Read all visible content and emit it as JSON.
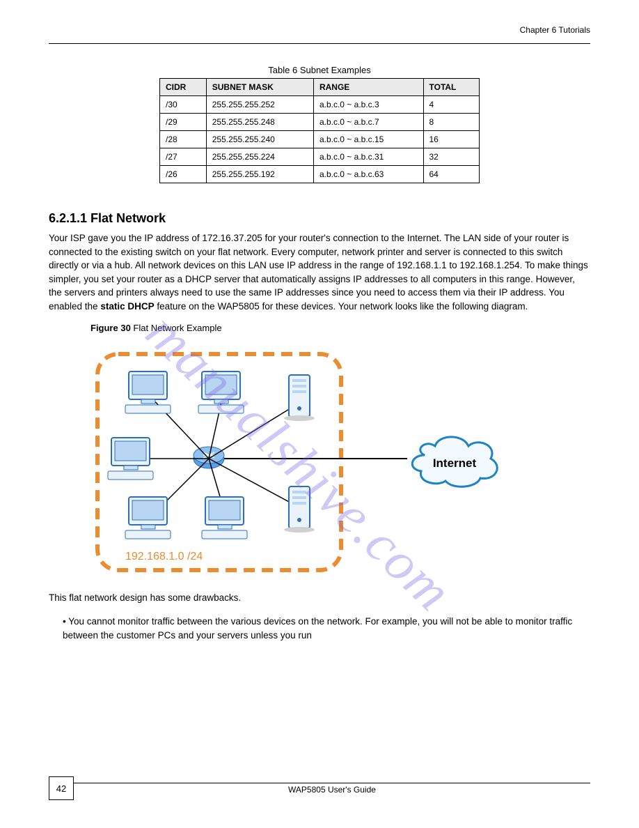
{
  "header": {
    "chapter": "Chapter 6 Tutorials"
  },
  "table": {
    "caption": "Table 6   Subnet Examples",
    "headers": [
      "CIDR",
      "SUBNET MASK",
      "RANGE",
      "TOTAL"
    ],
    "rows": [
      [
        "/30",
        "255.255.255.252",
        "a.b.c.0 ~ a.b.c.3",
        "4"
      ],
      [
        "/29",
        "255.255.255.248",
        "a.b.c.0 ~ a.b.c.7",
        "8"
      ],
      [
        "/28",
        "255.255.255.240",
        "a.b.c.0 ~ a.b.c.15",
        "16"
      ],
      [
        "/27",
        "255.255.255.224",
        "a.b.c.0 ~ a.b.c.31",
        "32"
      ],
      [
        "/26",
        "255.255.255.192",
        "a.b.c.0 ~ a.b.c.63",
        "64"
      ]
    ]
  },
  "section": {
    "heading": "6.2.1.1  Flat Network",
    "p1_a": "Your ISP gave you the IP address of 172.16.37.205 for your router's connection to the Internet. The LAN side of your router is connected to the existing switch on your flat network. Every computer, network printer and server is connected to this switch directly or via a hub. All network devices on this LAN use IP address in the range of 192.168.1.1 to 192.168.1.254. To make things simpler, you set your router as a DHCP server that automatically assigns IP addresses to all computers in this range. However, the servers and printers always need to use the same IP addresses since you need to access them via their IP address. You enabled the ",
    "p1_bold": "static DHCP",
    "p1_b": " feature on the WAP5805 for these devices. Your network looks like the following diagram.",
    "bottom_lead": "This flat network design has some drawbacks.",
    "bullet": "• You cannot monitor traffic between the various devices on the network. For example, you will not be able to monitor traffic between the customer PCs and your servers unless you run"
  },
  "figure": {
    "label": "Figure 30   ",
    "title": "Flat Network Example",
    "network_label": "192.168.1.0 /24",
    "internet": "Internet"
  },
  "footer": {
    "pagenum": "42",
    "doc": "WAP5805 User's Guide"
  },
  "watermark": "manualshive.com"
}
